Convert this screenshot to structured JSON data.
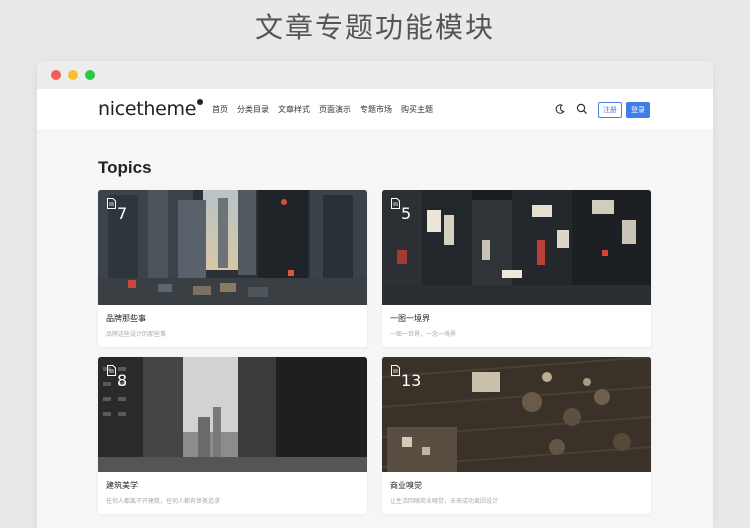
{
  "slide_title": "文章专题功能模块",
  "header": {
    "logo": "nicetheme",
    "nav": [
      "首页",
      "分类目录",
      "文章样式",
      "页面演示",
      "专题市场",
      "购买主题"
    ],
    "register_label": "注册",
    "login_label": "登录",
    "accent": "#3f7de8"
  },
  "topics": {
    "heading": "Topics",
    "cards": [
      {
        "count": "7",
        "title": "品牌那些事",
        "subtitle": "品牌这些设计的那些事"
      },
      {
        "count": "5",
        "title": "一图一境界",
        "subtitle": "一图一世界，一念一境界"
      },
      {
        "count": "8",
        "title": "建筑美学",
        "subtitle": "任何人都离不开建筑，任何人都有审美追求"
      },
      {
        "count": "13",
        "title": "商业嗅觉",
        "subtitle": "让生活回嗅商业嗅觉，未来成功离因设计"
      }
    ]
  }
}
